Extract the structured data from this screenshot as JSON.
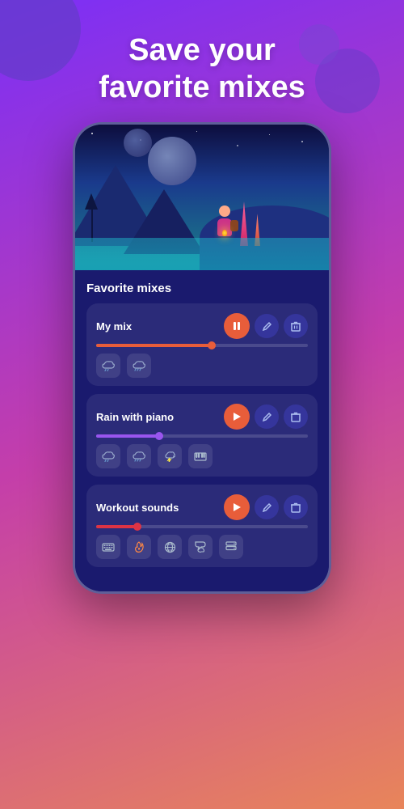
{
  "header": {
    "title_line1": "Save your",
    "title_line2": "favorite mixes"
  },
  "colors": {
    "bg_gradient_start": "#7b2ff7",
    "bg_gradient_mid": "#c43eaa",
    "bg_gradient_end": "#e8855a",
    "accent_orange": "#e85d3a",
    "accent_purple": "#9955ee",
    "accent_red": "#dd3344",
    "card_bg": "rgba(255,255,255,0.08)",
    "app_bg": "#1a1a6e"
  },
  "section": {
    "title": "Favorite mixes"
  },
  "mixes": [
    {
      "id": "my-mix",
      "name": "My mix",
      "playing": true,
      "progress": 55,
      "progress_color": "orange",
      "sounds": [
        "🌧",
        "🌧"
      ],
      "sound_labels": [
        "light-rain",
        "heavy-rain"
      ]
    },
    {
      "id": "rain-piano",
      "name": "Rain with piano",
      "playing": false,
      "progress": 30,
      "progress_color": "purple",
      "sounds": [
        "🌧",
        "🌧",
        "⛈",
        "🎹"
      ],
      "sound_labels": [
        "light-rain",
        "heavy-rain",
        "thunder",
        "piano"
      ]
    },
    {
      "id": "workout-sounds",
      "name": "Workout sounds",
      "playing": false,
      "progress": 20,
      "progress_color": "red",
      "sounds": [
        "⌨",
        "🔥",
        "🌐",
        "💬",
        "🗄"
      ],
      "sound_labels": [
        "keyboard",
        "fire",
        "globe",
        "chat",
        "server"
      ]
    }
  ],
  "buttons": {
    "pause_label": "⏸",
    "play_label": "▶",
    "edit_label": "✎",
    "delete_label": "🗑"
  }
}
